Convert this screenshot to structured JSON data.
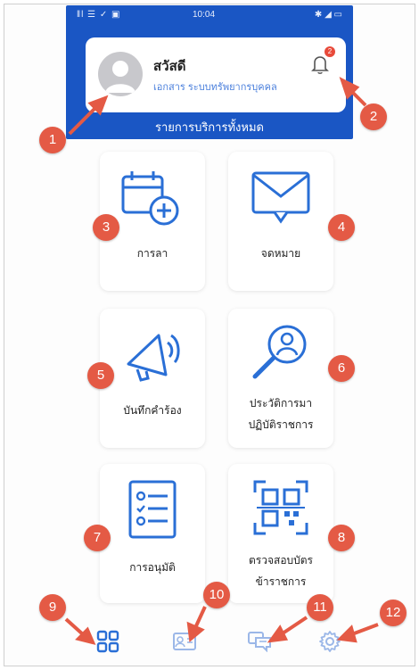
{
  "statusbar": {
    "left_icons": "ǁl ☰ ✓ ▣",
    "time": "10:04",
    "right_icons": "✱ ◢ ▭"
  },
  "header": {
    "greeting": "สวัสดี",
    "subtitle": "เอกสาร ระบบทรัพยากรบุคคล",
    "notification_count": "2",
    "section_title": "รายการบริการทั้งหมด"
  },
  "tiles": [
    {
      "label": "การลา",
      "icon": "calendar-add-icon"
    },
    {
      "label": "จดหมาย",
      "icon": "envelope-icon"
    },
    {
      "label": "บันทึกคำร้อง",
      "icon": "megaphone-icon"
    },
    {
      "label": "ประวัติการมา",
      "label2": "ปฏิบัติราชการ",
      "icon": "user-search-icon"
    },
    {
      "label": "การอนุมัติ",
      "icon": "checklist-icon"
    },
    {
      "label": "ตรวจสอบบัตร",
      "label2": "ข้าราชการ",
      "icon": "qr-code-icon"
    }
  ],
  "bottom_nav": [
    {
      "icon": "grid-icon",
      "active": true
    },
    {
      "icon": "id-card-icon",
      "active": false
    },
    {
      "icon": "chat-icon",
      "active": false
    },
    {
      "icon": "gear-icon",
      "active": false
    }
  ],
  "markers": [
    "1",
    "2",
    "3",
    "4",
    "5",
    "6",
    "7",
    "8",
    "9",
    "10",
    "11",
    "12"
  ],
  "colors": {
    "primary": "#1a56c4",
    "marker": "#e45a45",
    "icon_blue": "#2a6fd6",
    "nav_inactive": "#9bb7e8"
  }
}
